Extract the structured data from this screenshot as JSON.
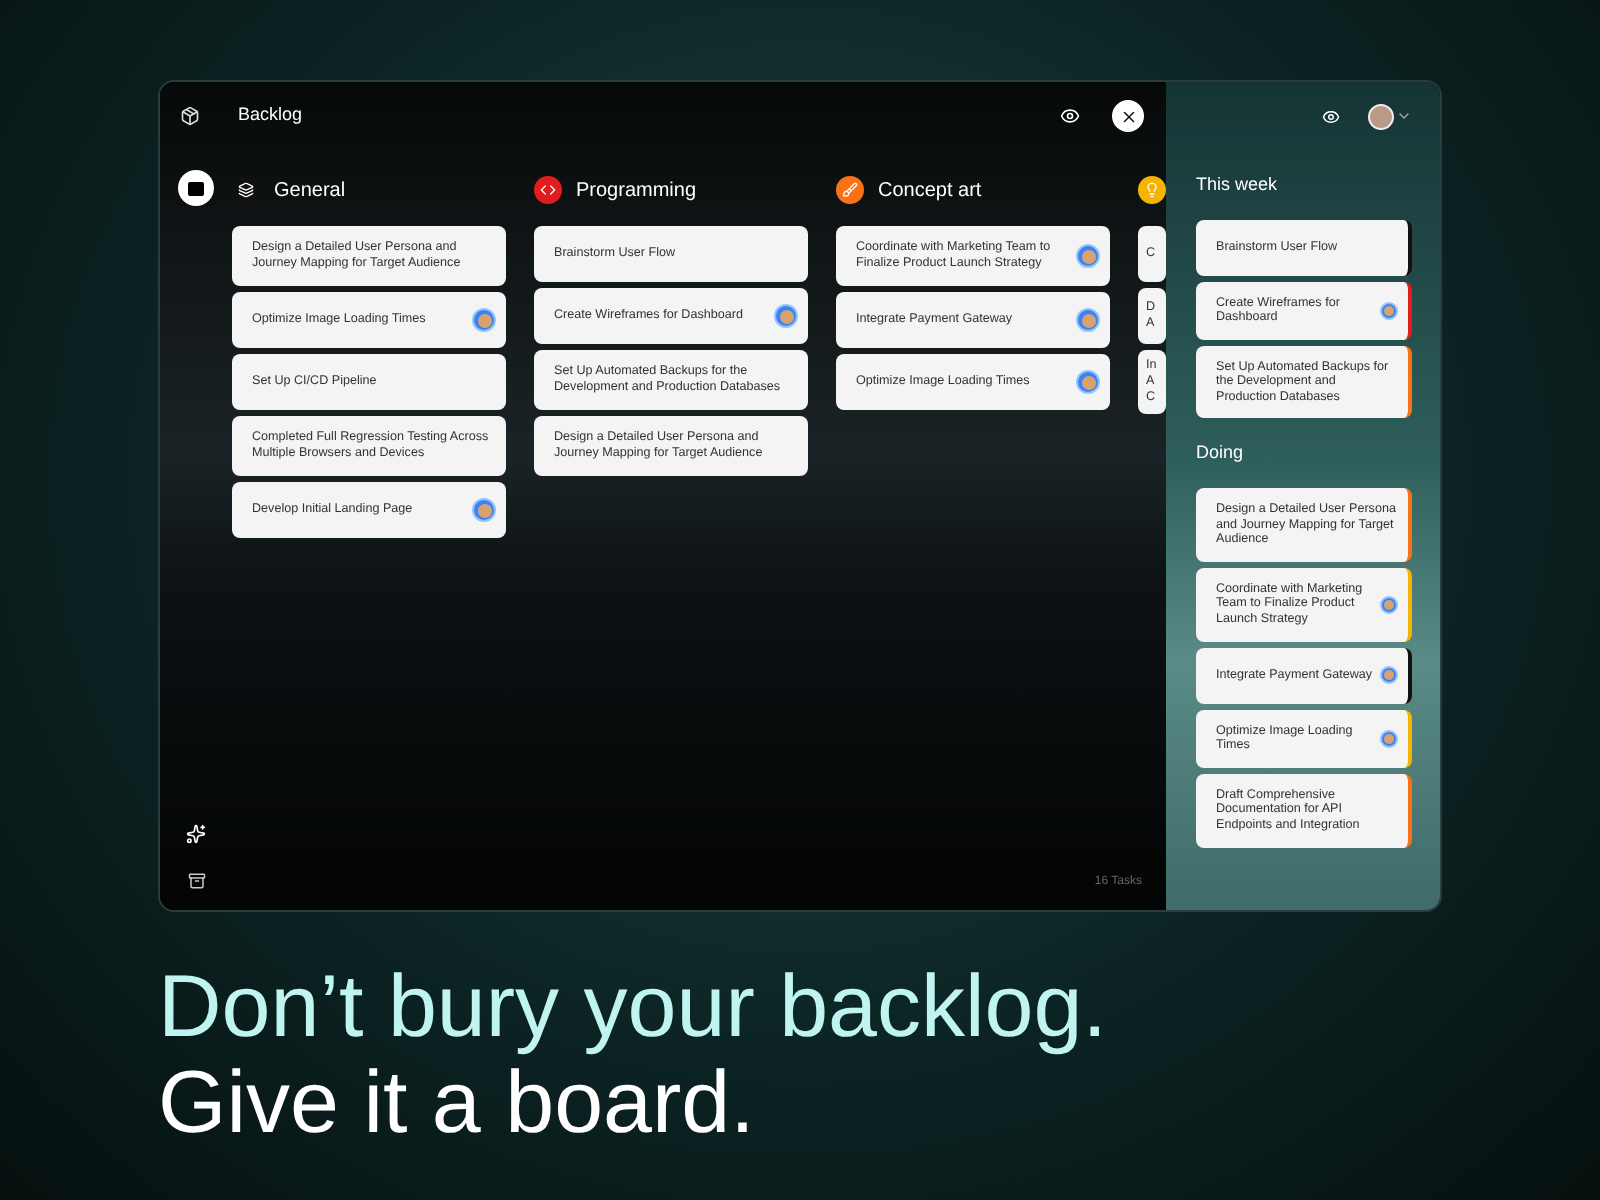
{
  "window": {
    "title": "Backlog"
  },
  "columns": [
    {
      "name": "General",
      "kind": "layers",
      "color": "#111111",
      "cards": [
        {
          "lines": [
            "Design a Detailed User Persona and Journey Mapping for Target Audience"
          ],
          "assignee": false
        },
        {
          "lines": [
            "Optimize Image Loading Times"
          ],
          "assignee": true
        },
        {
          "lines": [
            "Set Up CI/CD Pipeline"
          ],
          "assignee": false
        },
        {
          "lines": [
            "Completed Full Regression Testing Across Multiple Browsers and Devices"
          ],
          "assignee": false
        },
        {
          "lines": [
            "Develop Initial Landing Page"
          ],
          "assignee": true
        }
      ]
    },
    {
      "name": "Programming",
      "kind": "code",
      "color": "#e11d1d",
      "cards": [
        {
          "lines": [
            "Brainstorm User Flow"
          ],
          "assignee": false
        },
        {
          "lines": [
            "Create Wireframes for Dashboard"
          ],
          "assignee": true
        },
        {
          "lines": [
            "Set Up Automated Backups for the Development and Production Databases"
          ],
          "assignee": false
        },
        {
          "lines": [
            "Design a Detailed User Persona and Journey Mapping for Target Audience"
          ],
          "assignee": false
        }
      ]
    },
    {
      "name": "Concept art",
      "kind": "brush",
      "color": "#f97316",
      "cards": [
        {
          "lines": [
            "Coordinate with Marketing Team to Finalize Product Launch Strategy"
          ],
          "assignee": true
        },
        {
          "lines": [
            "Integrate Payment Gateway"
          ],
          "assignee": true
        },
        {
          "lines": [
            "Optimize Image Loading Times"
          ],
          "assignee": true
        }
      ]
    },
    {
      "kind": "bulb",
      "color": "#f5b400",
      "cards": [
        {
          "lines": [
            "C"
          ],
          "assignee": false
        },
        {
          "lines": [
            "D",
            "A"
          ],
          "assignee": false
        },
        {
          "lines": [
            "In",
            "A",
            "C"
          ],
          "assignee": false
        }
      ]
    }
  ],
  "task_count": "16 Tasks",
  "side_panel": {
    "groups": [
      {
        "title": "This week",
        "cards": [
          {
            "text": "Brainstorm User Flow",
            "assignee": false,
            "color": "#111111"
          },
          {
            "text": "Create Wireframes for Dashboard",
            "assignee": true,
            "color": "#e11d1d"
          },
          {
            "text": "Set Up Automated Backups for the Development and Production Databases",
            "assignee": false,
            "color": "#f97316"
          }
        ]
      },
      {
        "title": "Doing",
        "cards": [
          {
            "text": "Design a Detailed User Persona and Journey Mapping for Target Audience",
            "assignee": false,
            "color": "#f97316"
          },
          {
            "text": "Coordinate with Marketing Team to Finalize Product Launch Strategy",
            "assignee": true,
            "color": "#f5b400"
          },
          {
            "text": "Integrate Payment Gateway",
            "assignee": true,
            "color": "#111111"
          },
          {
            "text": "Optimize Image Loading Times",
            "assignee": true,
            "color": "#f5b400"
          },
          {
            "text": "Draft Comprehensive Documentation for API Endpoints and Integration",
            "assignee": false,
            "color": "#f97316"
          }
        ]
      }
    ]
  },
  "headline": [
    "Don’t bury your backlog.",
    "Give it a board."
  ]
}
